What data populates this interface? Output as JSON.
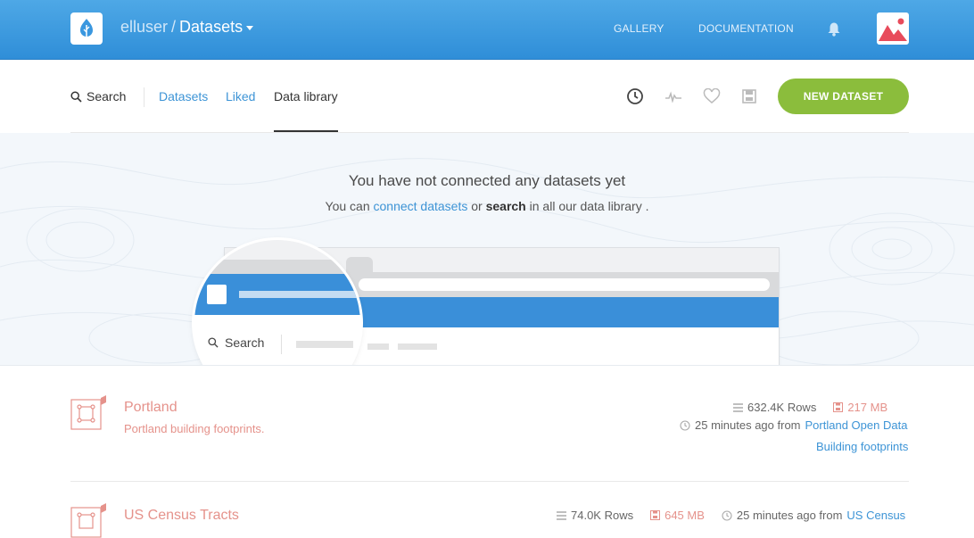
{
  "header": {
    "user": "elluser",
    "separator": "/",
    "section": "Datasets",
    "nav": [
      "GALLERY",
      "DOCUMENTATION"
    ],
    "brand_color": "#3a97df"
  },
  "subnav": {
    "search_label": "Search",
    "tabs": [
      "Datasets",
      "Liked",
      "Data library"
    ],
    "active_tab": "Data library",
    "new_dataset": "NEW DATASET",
    "accent_color": "#8bbd3c"
  },
  "empty_state": {
    "title": "You have not connected any datasets yet",
    "prefix": "You can",
    "link": "connect datasets",
    "middle": "or",
    "bold": "search",
    "suffix": "in all our data library .",
    "illustration_search": "Search"
  },
  "datasets": [
    {
      "title": "Portland",
      "description": "Portland building footprints.",
      "rows": "632.4K Rows",
      "size": "217 MB",
      "time": "25 minutes ago from",
      "source": "Portland Open Data",
      "source2": "Building footprints"
    },
    {
      "title": "US Census Tracts",
      "rows": "74.0K Rows",
      "size": "645 MB",
      "time": "25 minutes ago from",
      "source": "US Census"
    }
  ]
}
